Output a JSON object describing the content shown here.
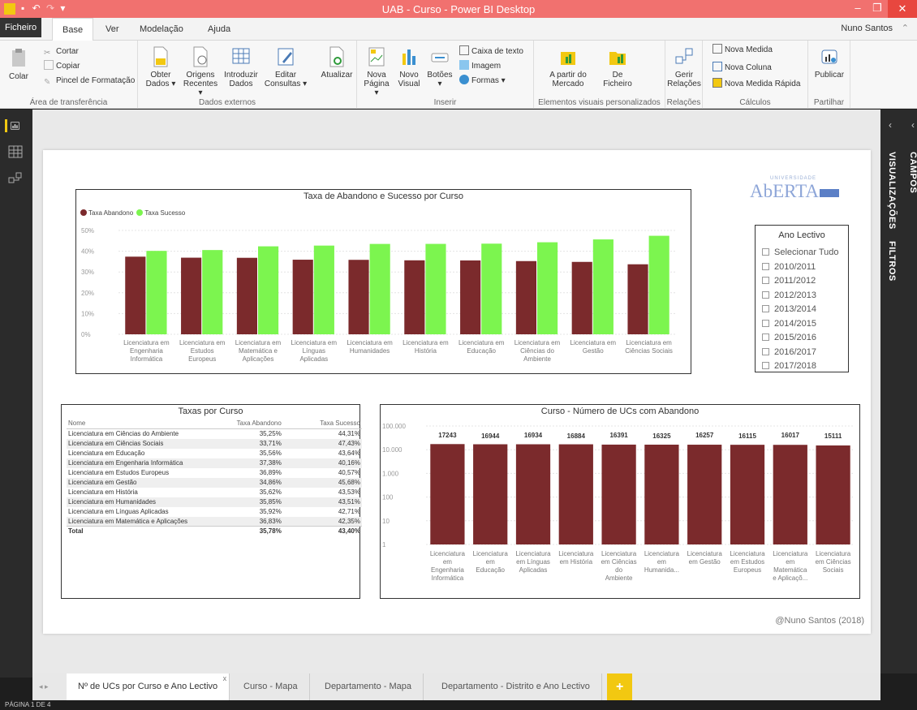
{
  "window": {
    "title": "UAB - Curso - Power BI Desktop",
    "minimize": "–",
    "restore": "❐",
    "close": "✕"
  },
  "menu": {
    "file": "Ficheiro",
    "tabs": [
      "Base",
      "Ver",
      "Modelação",
      "Ajuda"
    ],
    "user": "Nuno Santos"
  },
  "ribbon": {
    "clipboard": {
      "label": "Área de transferência",
      "paste": "Colar",
      "cut": "Cortar",
      "copy": "Copiar",
      "format_painter": "Pincel de Formatação"
    },
    "external_data": {
      "label": "Dados externos",
      "get_data": [
        "Obter",
        "Dados ▾"
      ],
      "recent_sources": [
        "Origens",
        "Recentes ▾"
      ],
      "enter_data": [
        "Introduzir",
        "Dados"
      ],
      "edit_queries": [
        "Editar",
        "Consultas ▾"
      ]
    },
    "refresh": "Atualizar",
    "insert": {
      "label": "Inserir",
      "new_page": [
        "Nova",
        "Página ▾"
      ],
      "new_visual": [
        "Novo",
        "Visual"
      ],
      "buttons": [
        "Botões",
        "▾"
      ],
      "text_box": "Caixa de texto",
      "image": "Imagem",
      "shapes": "Formas ▾"
    },
    "custom_visuals": {
      "label": "Elementos visuais personalizados",
      "marketplace": [
        "A partir do",
        "Mercado"
      ],
      "from_file": [
        "De",
        "Ficheiro"
      ]
    },
    "relationships": {
      "label": "Relações",
      "manage": [
        "Gerir",
        "Relações"
      ]
    },
    "calculations": {
      "label": "Cálculos",
      "new_measure": "Nova Medida",
      "new_column": "Nova Coluna",
      "quick_measure": "Nova Medida Rápida"
    },
    "share": {
      "label": "Partilhar",
      "publish": "Publicar"
    }
  },
  "right_panes": {
    "fields": "CAMPOS",
    "visualizations": "VISUALIZAÇÕES",
    "filters": "FILTROS"
  },
  "logo": {
    "small": "UNIVERSIDADE",
    "big": "AbERTA"
  },
  "chart_data": [
    {
      "type": "bar",
      "title": "Taxa de Abandono e Sucesso por Curso",
      "legend_position": "top-left",
      "categories": [
        "Licenciatura em Engenharia Informática",
        "Licenciatura em Estudos Europeus",
        "Licenciatura em Matemática e Aplicações",
        "Licenciatura em Línguas Aplicadas",
        "Licenciatura em Humanidades",
        "Licenciatura em História",
        "Licenciatura em Educação",
        "Licenciatura em Ciências do Ambiente",
        "Licenciatura em Gestão",
        "Licenciatura em Ciências Sociais"
      ],
      "category_lines": [
        [
          "Licenciatura em",
          "Engenharia",
          "Informática"
        ],
        [
          "Licenciatura em",
          "Estudos",
          "Europeus"
        ],
        [
          "Licenciatura em",
          "Matemática e",
          "Aplicações"
        ],
        [
          "Licenciatura em",
          "Línguas",
          "Aplicadas"
        ],
        [
          "Licenciatura em",
          "Humanidades"
        ],
        [
          "Licenciatura em",
          "História"
        ],
        [
          "Licenciatura em",
          "Educação"
        ],
        [
          "Licenciatura em",
          "Ciências do",
          "Ambiente"
        ],
        [
          "Licenciatura em",
          "Gestão"
        ],
        [
          "Licenciatura em",
          "Ciências Sociais"
        ]
      ],
      "series": [
        {
          "name": "Taxa Abandono",
          "color": "#7b2a2c",
          "values": [
            37.38,
            36.89,
            36.83,
            35.92,
            35.85,
            35.62,
            35.56,
            35.25,
            34.86,
            33.71
          ]
        },
        {
          "name": "Taxa Sucesso",
          "color": "#7cf54f",
          "values": [
            40.16,
            40.57,
            42.35,
            42.71,
            43.51,
            43.53,
            43.64,
            44.31,
            45.68,
            47.43
          ]
        }
      ],
      "yticks": [
        "0%",
        "10%",
        "20%",
        "30%",
        "40%",
        "50%"
      ],
      "ylim": [
        0,
        50
      ],
      "grid": true
    },
    {
      "type": "bar",
      "title": "Curso - Número de UCs com Abandono",
      "yscale": "log",
      "yticks": [
        "1",
        "10",
        "100",
        "1.000",
        "10.000",
        "100.000"
      ],
      "ylim": [
        1,
        100000
      ],
      "bar_color": "#7b2a2c",
      "categories": [
        "Licenciatura em Engenharia Informática",
        "Licenciatura em Educação",
        "Licenciatura em Línguas Aplicadas",
        "Licenciatura em História",
        "Licenciatura em Ciências do Ambiente",
        "Licenciatura em Humanidades",
        "Licenciatura em Gestão",
        "Licenciatura em Estudos Europeus",
        "Licenciatura em Matemática e Aplicações",
        "Licenciatura em Ciências Sociais"
      ],
      "category_lines": [
        [
          "Licenciatura",
          "em",
          "Engenharia",
          "Informática"
        ],
        [
          "Licenciatura",
          "em",
          "Educação"
        ],
        [
          "Licenciatura",
          "em Línguas",
          "Aplicadas"
        ],
        [
          "Licenciatura",
          "em História"
        ],
        [
          "Licenciatura",
          "em Ciências",
          "do",
          "Ambiente"
        ],
        [
          "Licenciatura",
          "em",
          "Humanida..."
        ],
        [
          "Licenciatura",
          "em Gestão"
        ],
        [
          "Licenciatura",
          "em Estudos",
          "Europeus"
        ],
        [
          "Licenciatura",
          "em",
          "Matemática",
          "e Aplicaçõ..."
        ],
        [
          "Licenciatura",
          "em Ciências",
          "Sociais"
        ]
      ],
      "values": [
        17243,
        16944,
        16934,
        16884,
        16391,
        16325,
        16257,
        16115,
        16017,
        15111
      ]
    }
  ],
  "slicer": {
    "title": "Ano Lectivo",
    "items": [
      "Selecionar Tudo",
      "2010/2011",
      "2011/2012",
      "2012/2013",
      "2013/2014",
      "2014/2015",
      "2015/2016",
      "2016/2017",
      "2017/2018"
    ]
  },
  "table": {
    "title": "Taxas por Curso",
    "columns": [
      "Nome",
      "Taxa Abandono",
      "Taxa Sucesso"
    ],
    "rows": [
      [
        "Licenciatura em Ciências do Ambiente",
        "35,25%",
        "44,31%"
      ],
      [
        "Licenciatura em Ciências Sociais",
        "33,71%",
        "47,43%"
      ],
      [
        "Licenciatura em Educação",
        "35,56%",
        "43,64%"
      ],
      [
        "Licenciatura em Engenharia Informática",
        "37,38%",
        "40,16%"
      ],
      [
        "Licenciatura em Estudos Europeus",
        "36,89%",
        "40,57%"
      ],
      [
        "Licenciatura em Gestão",
        "34,86%",
        "45,68%"
      ],
      [
        "Licenciatura em História",
        "35,62%",
        "43,53%"
      ],
      [
        "Licenciatura em Humanidades",
        "35,85%",
        "43,51%"
      ],
      [
        "Licenciatura em Línguas Aplicadas",
        "35,92%",
        "42,71%"
      ],
      [
        "Licenciatura em Matemática e Aplicações",
        "36,83%",
        "42,35%"
      ]
    ],
    "total": [
      "Total",
      "35,78%",
      "43,40%"
    ]
  },
  "credit": "@Nuno Santos (2018)",
  "page_tabs": [
    "Nº de UCs por Curso e Ano Lectivo",
    "Curso - Mapa",
    "Departamento - Mapa",
    "Departamento - Distrito e Ano Lectivo"
  ],
  "add_page": "+",
  "tab_close": "x",
  "status": "PÁGINA 1 DE 4"
}
